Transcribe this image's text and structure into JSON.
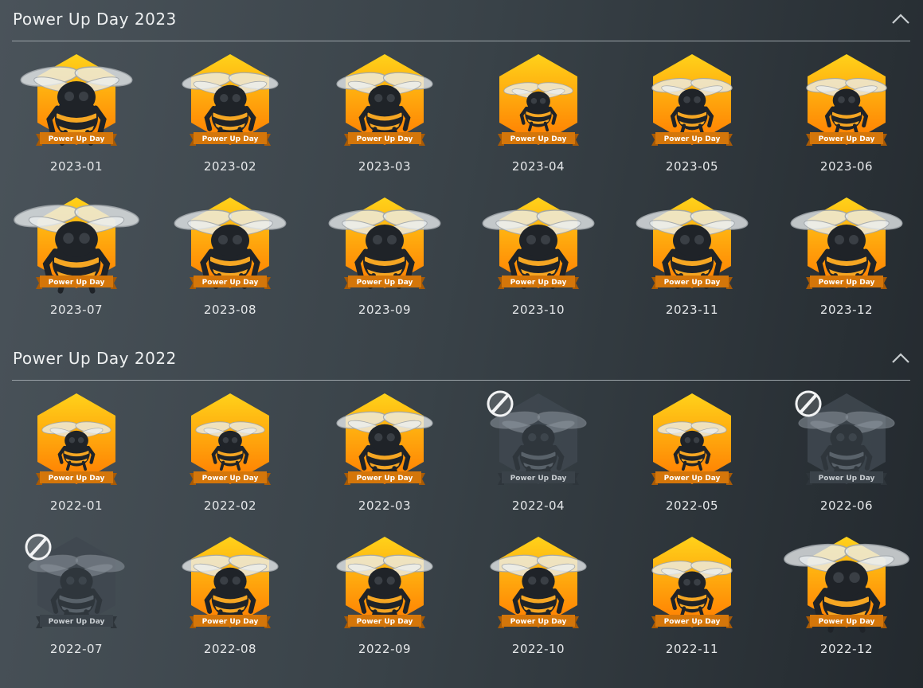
{
  "sections": [
    {
      "title": "Power Up Day 2023",
      "badges": [
        {
          "date": "2023-01",
          "banner": "Power Up Day",
          "state": "earned",
          "bee": "large"
        },
        {
          "date": "2023-02",
          "banner": "Power Up Day",
          "state": "earned",
          "bee": "medium"
        },
        {
          "date": "2023-03",
          "banner": "Power Up Day",
          "state": "earned",
          "bee": "medium"
        },
        {
          "date": "2023-04",
          "banner": "Power Up Day",
          "state": "earned",
          "bee": "small"
        },
        {
          "date": "2023-05",
          "banner": "Power Up Day",
          "state": "earned",
          "bee": "small-medium"
        },
        {
          "date": "2023-06",
          "banner": "Power Up Day",
          "state": "earned",
          "bee": "small-medium"
        },
        {
          "date": "2023-07",
          "banner": "Power Up Day",
          "state": "earned",
          "bee": "xlarge"
        },
        {
          "date": "2023-08",
          "banner": "Power Up Day",
          "state": "earned",
          "bee": "large"
        },
        {
          "date": "2023-09",
          "banner": "Power Up Day",
          "state": "earned",
          "bee": "large"
        },
        {
          "date": "2023-10",
          "banner": "Power Up Day",
          "state": "earned",
          "bee": "large"
        },
        {
          "date": "2023-11",
          "banner": "Power Up Day",
          "state": "earned",
          "bee": "large"
        },
        {
          "date": "2023-12",
          "banner": "Power Up Day",
          "state": "earned",
          "bee": "large"
        }
      ]
    },
    {
      "title": "Power Up Day 2022",
      "badges": [
        {
          "date": "2022-01",
          "banner": "Power Up Day",
          "state": "earned",
          "bee": "small"
        },
        {
          "date": "2022-02",
          "banner": "Power Up Day",
          "state": "earned",
          "bee": "small"
        },
        {
          "date": "2022-03",
          "banner": "Power Up Day",
          "state": "earned",
          "bee": "medium"
        },
        {
          "date": "2022-04",
          "banner": "Power Up Day",
          "state": "locked",
          "bee": "medium"
        },
        {
          "date": "2022-05",
          "banner": "Power Up Day",
          "state": "earned",
          "bee": "small"
        },
        {
          "date": "2022-06",
          "banner": "Power Up Day",
          "state": "locked",
          "bee": "medium"
        },
        {
          "date": "2022-07",
          "banner": "Power Up Day",
          "state": "locked",
          "bee": "medium"
        },
        {
          "date": "2022-08",
          "banner": "Power Up Day",
          "state": "earned",
          "bee": "medium"
        },
        {
          "date": "2022-09",
          "banner": "Power Up Day",
          "state": "earned",
          "bee": "medium"
        },
        {
          "date": "2022-10",
          "banner": "Power Up Day",
          "state": "earned",
          "bee": "medium"
        },
        {
          "date": "2022-11",
          "banner": "Power Up Day",
          "state": "earned",
          "bee": "small-medium"
        },
        {
          "date": "2022-12",
          "banner": "Power Up Day",
          "state": "earned",
          "bee": "xlarge"
        }
      ]
    }
  ],
  "icons": {
    "collapse": "chevron-up-icon",
    "locked": "locked-slash-icon"
  },
  "colors": {
    "hex_light": "#ffd21a",
    "hex_dark": "#ff7a00",
    "banner": "#d4760a",
    "locked": "#4a535b"
  }
}
